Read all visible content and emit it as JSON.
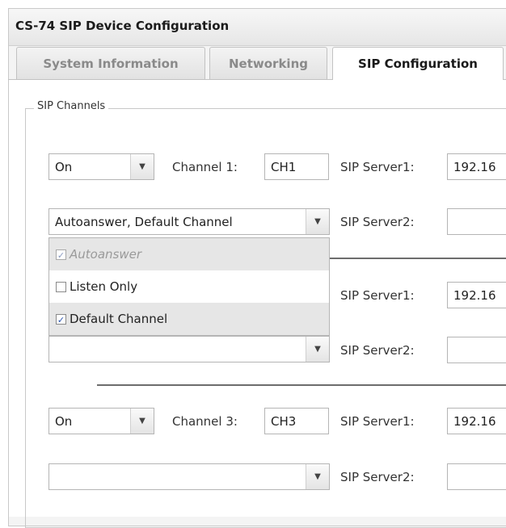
{
  "window": {
    "title": "CS-74 SIP Device Configuration"
  },
  "tabs": [
    {
      "label": "System Information",
      "active": false
    },
    {
      "label": "Networking",
      "active": false
    },
    {
      "label": "SIP Configuration",
      "active": true
    }
  ],
  "sip_channels": {
    "legend": "SIP Channels",
    "channels": [
      {
        "mode": "On",
        "channel_label": "Channel 1:",
        "channel_value": "CH1",
        "server1_label": "SIP Server1:",
        "server1_value": "192.16",
        "options_value": "Autoanswer, Default Channel",
        "server2_label": "SIP Server2:",
        "server2_value": ""
      },
      {
        "mode": "",
        "channel_label": "",
        "channel_value": "",
        "server1_label": "SIP Server1:",
        "server1_value": "192.16",
        "options_value": "",
        "server2_label": "SIP Server2:",
        "server2_value": ""
      },
      {
        "mode": "On",
        "channel_label": "Channel 3:",
        "channel_value": "CH3",
        "server1_label": "SIP Server1:",
        "server1_value": "192.16",
        "options_value": "",
        "server2_label": "SIP Server2:",
        "server2_value": ""
      }
    ],
    "dropdown_options": [
      {
        "label": "Autoanswer",
        "checked": true,
        "disabled": true,
        "check_mark": "✓"
      },
      {
        "label": "Listen Only",
        "checked": false,
        "disabled": false,
        "check_mark": ""
      },
      {
        "label": "Default Channel",
        "checked": true,
        "disabled": false,
        "check_mark": "✓"
      }
    ]
  },
  "icons": {
    "select_arrow": "▼"
  }
}
